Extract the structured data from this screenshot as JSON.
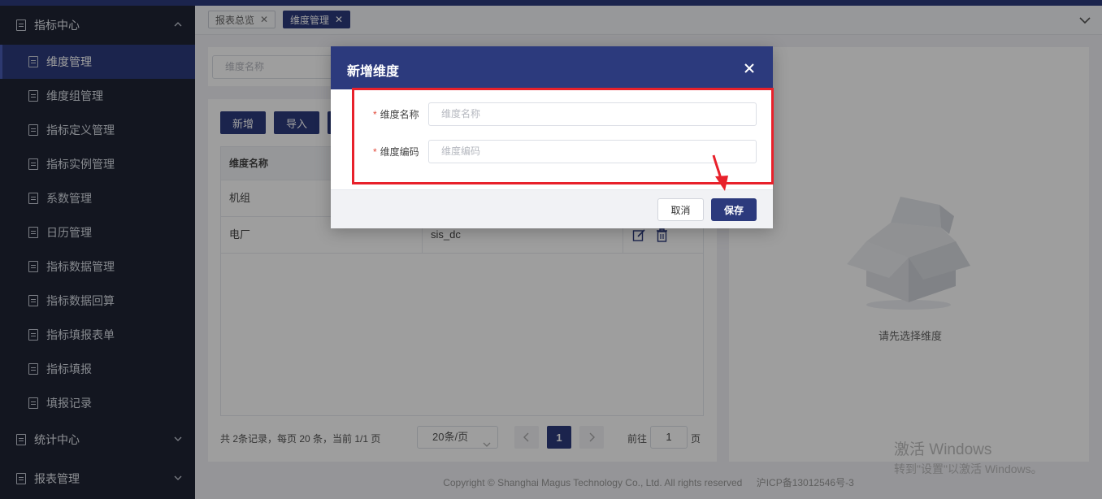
{
  "sidebar": {
    "group_metrics": "指标中心",
    "items": [
      {
        "label": "维度管理",
        "active": true
      },
      {
        "label": "维度组管理"
      },
      {
        "label": "指标定义管理"
      },
      {
        "label": "指标实例管理"
      },
      {
        "label": "系数管理"
      },
      {
        "label": "日历管理"
      },
      {
        "label": "指标数据管理"
      },
      {
        "label": "指标数据回算"
      },
      {
        "label": "指标填报表单"
      },
      {
        "label": "指标填报"
      },
      {
        "label": "填报记录"
      }
    ],
    "group_stats": "统计中心",
    "group_reports": "报表管理"
  },
  "tabs": [
    {
      "label": "报表总览"
    },
    {
      "label": "维度管理",
      "active": true
    }
  ],
  "toolbar": {
    "search_placeholder": "维度名称",
    "add_label": "新增",
    "import_label": "导入"
  },
  "table": {
    "headers": [
      "维度名称"
    ],
    "rows": [
      {
        "name": "机组",
        "code": ""
      },
      {
        "name": "电厂",
        "code": "sis_dc"
      }
    ]
  },
  "pagination": {
    "summary": "共 2条记录，每页 20 条，当前 1/1 页",
    "page_size": "20条/页",
    "current_page": "1",
    "goto_label": "前往",
    "goto_value": "1",
    "page_suffix": "页"
  },
  "empty_panel": {
    "text": "请先选择维度"
  },
  "footer": {
    "copyright": "Copyright © Shanghai Magus Technology Co., Ltd. All rights reserved",
    "icp": "沪ICP备13012546号-3"
  },
  "watermark": {
    "line1": "激活 Windows",
    "line2": "转到\"设置\"以激活 Windows。"
  },
  "dialog": {
    "title": "新增维度",
    "name_label": "维度名称",
    "name_placeholder": "维度名称",
    "code_label": "维度编码",
    "code_placeholder": "维度编码",
    "cancel_label": "取消",
    "save_label": "保存"
  },
  "colors": {
    "primary": "#2c3a7d",
    "sidebar_bg": "#1f2535",
    "highlight": "#e8212b",
    "required": "#e24a3b"
  }
}
